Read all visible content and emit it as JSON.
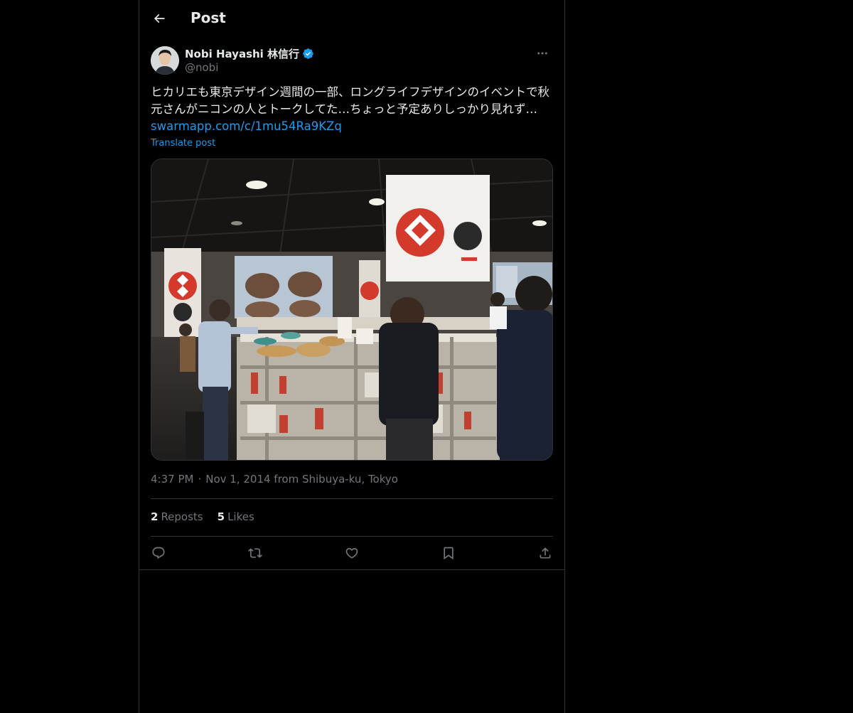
{
  "header": {
    "title": "Post"
  },
  "author": {
    "display_name": "Nobi Hayashi 林信行",
    "handle": "@nobi",
    "verified": true
  },
  "post": {
    "text": "ヒカリエも東京デザイン週間の一部、ロングライフデザインのイベントで秋元さんがニコンの人とトークしてた…ちょっと予定ありしっかり見れず… ",
    "link": "swarmapp.com/c/1mu54Ra9KZq",
    "translate_label": "Translate post",
    "time": "4:37 PM",
    "separator": "·",
    "date_location": "Nov 1, 2014 from Shibuya-ku, Tokyo"
  },
  "stats": {
    "reposts_count": "2",
    "reposts_label": "Reposts",
    "likes_count": "5",
    "likes_label": "Likes"
  },
  "icons": {
    "back": "arrow-left-icon",
    "more": "more-horizontal-icon",
    "verified": "verified-badge-icon",
    "reply": "reply-icon",
    "repost": "repost-icon",
    "like": "heart-icon",
    "bookmark": "bookmark-icon",
    "share": "share-icon"
  },
  "colors": {
    "background": "#000000",
    "text": "#e7e9ea",
    "muted": "#71767b",
    "accent": "#1d9bf0",
    "border": "#2f3336"
  }
}
